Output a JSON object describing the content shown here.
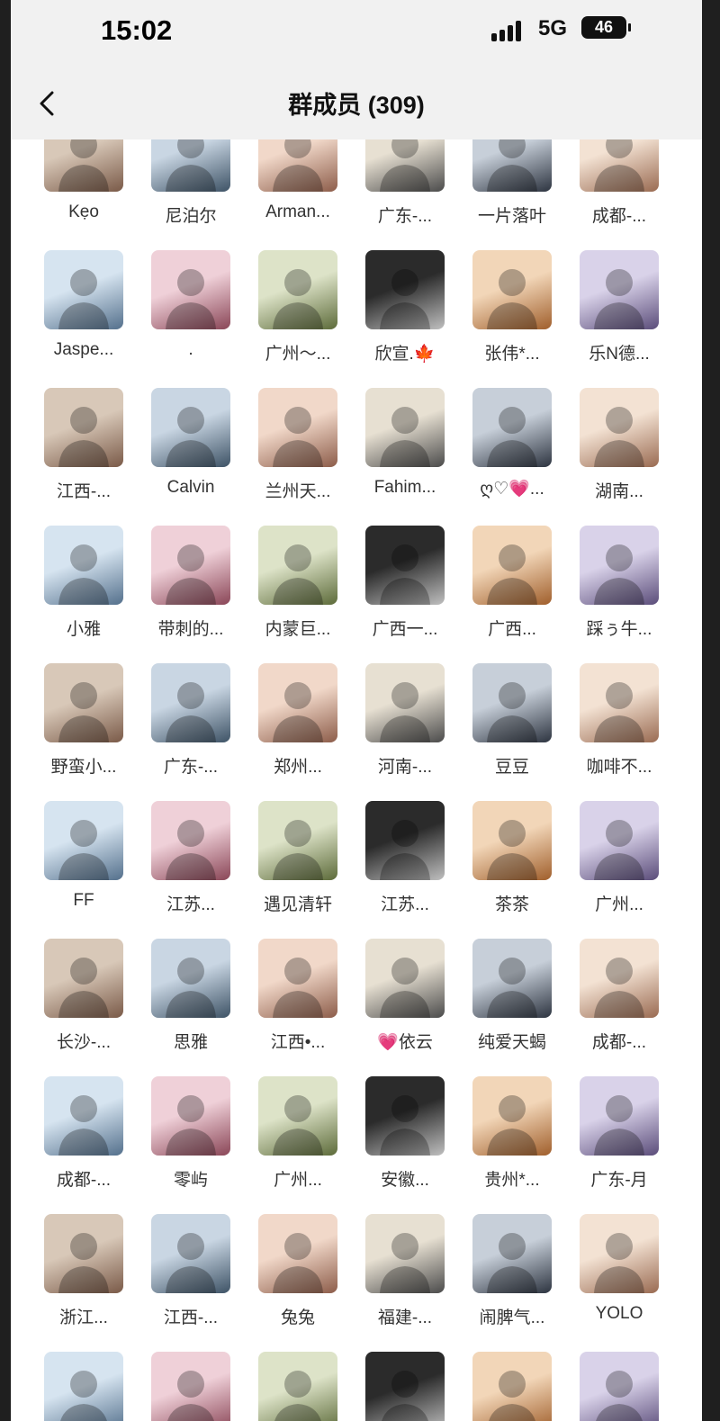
{
  "status_bar": {
    "time": "15:02",
    "network": "5G",
    "battery": "46"
  },
  "nav": {
    "title": "群成员 (309)"
  },
  "colors": {
    "background": "#ffffff",
    "bar": "#f1f1f1",
    "text": "#333333"
  },
  "members": [
    [
      "Kẹo",
      "尼泊尔",
      "Arman...",
      "广东-...",
      "一片落叶",
      "成都-..."
    ],
    [
      "Jaspe...",
      ".",
      "广州～...",
      "欣宣.🍁",
      "张伟*...",
      "乐N德..."
    ],
    [
      "江西-...",
      "Calvin",
      "兰州天...",
      "Fahim...",
      "ღ♡💗...",
      "湖南..."
    ],
    [
      "小雅",
      "带刺的...",
      "内蒙巨...",
      "广西一...",
      "广西...",
      "踩ぅ牛..."
    ],
    [
      "野蛮小...",
      "广东-...",
      "郑州...",
      "河南-...",
      "豆豆",
      "咖啡不..."
    ],
    [
      "FF",
      "江苏...",
      "遇见清轩",
      "江苏...",
      "茶茶",
      "广州..."
    ],
    [
      "长沙-...",
      "思雅",
      "江西•...",
      "💗依云",
      "纯爱天蝎",
      "成都-..."
    ],
    [
      "成都-...",
      "零屿",
      "广州...",
      "安徽...",
      "贵州*...",
      "广东-月"
    ],
    [
      "浙江...",
      "江西-...",
      "兔兔",
      "福建-...",
      "闹脾气...",
      "YOLO"
    ],
    [
      "",
      "",
      "",
      "",
      "",
      ""
    ]
  ]
}
